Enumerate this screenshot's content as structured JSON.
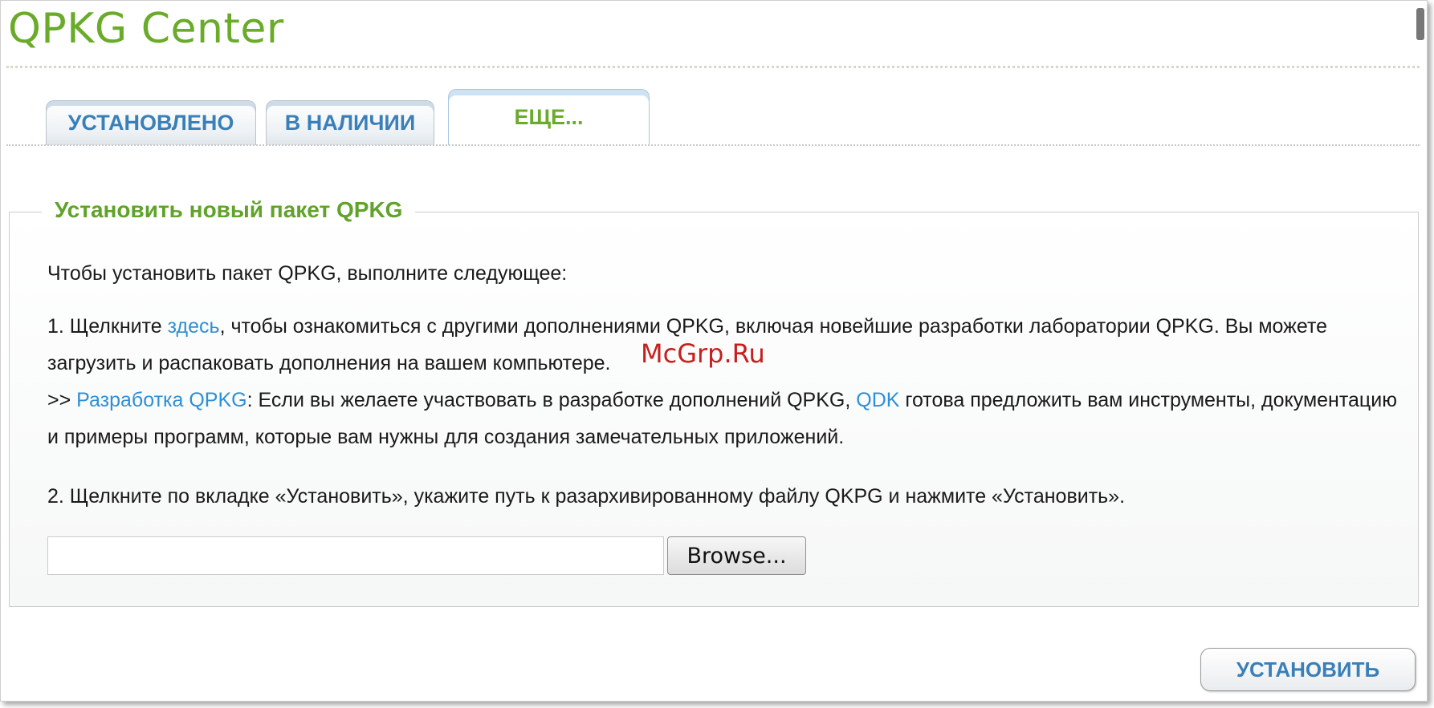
{
  "header": {
    "title": "QPKG Center"
  },
  "tabs": [
    {
      "label": "УСТАНОВЛЕНО"
    },
    {
      "label": "В НАЛИЧИИ"
    },
    {
      "label": "ЕЩЕ..."
    }
  ],
  "section": {
    "legend": "Установить новый пакет QPKG",
    "intro": "Чтобы установить пакет QPKG, выполните следующее:",
    "step1": {
      "prefix": "1. Щелкните ",
      "link": "здесь",
      "suffix": ", чтобы ознакомиться с другими дополнениями QPKG, включая новейшие разработки лаборатории QPKG. Вы можете загрузить и распаковать дополнения на вашем компьютере."
    },
    "dev": {
      "prefix": ">> ",
      "link": "Разработка QPKG",
      "middle": ": Если вы желаете участвовать в разработке дополнений QPKG, ",
      "link2": "QDK",
      "suffix": " готова предложить вам инструменты, документацию и примеры программ, которые вам нужны для создания замечательных приложений."
    },
    "step2": "2. Щелкните по вкладке «Установить», укажите путь к разархивированному файлу QKPG и нажмите «Установить».",
    "file_input": {
      "value": ""
    },
    "browse_label": "Browse..."
  },
  "actions": {
    "install_label": "УСТАНОВИТЬ"
  },
  "watermark": "McGrp.Ru",
  "colors": {
    "title_green": "#6aab2a",
    "tab_blue": "#3a7fb8",
    "link_blue": "#2f8fd6"
  }
}
